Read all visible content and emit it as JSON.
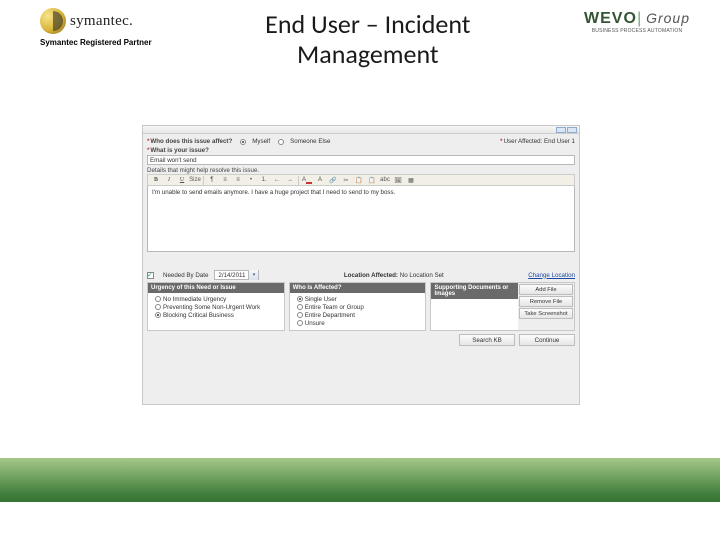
{
  "header": {
    "left_brand": "symantec.",
    "left_sub": "Symantec Registered Partner",
    "title_line1": "End User – Incident",
    "title_line2": "Management",
    "right_brand": "WEVO",
    "right_brand_suffix": "Group",
    "right_sub": "BUSINESS PROCESS AUTOMATION"
  },
  "form": {
    "q_affects": "Who does this issue affect?",
    "opt_myself": "Myself",
    "opt_someone": "Someone Else",
    "user_affected_label": "User Affected:",
    "user_affected_value": "End User 1",
    "q_issue": "What is your issue?",
    "issue_value": "Email won't send",
    "details_label": "Details that might help resolve this issue.",
    "details_body": "I'm unable to send emails anymore. I have a huge project that I need to send to my boss.",
    "needed_by_label": "Needed By Date",
    "needed_by_value": "2/14/2011",
    "loc_label": "Location Affected:",
    "loc_value": "No Location Set",
    "loc_link": "Change Location",
    "urgency": {
      "head": "Urgency of this Need or Issue",
      "opts": [
        "No Immediate Urgency",
        "Preventing Some Non-Urgent Work",
        "Blocking Critical Business"
      ],
      "selected": 2
    },
    "affected": {
      "head": "Who is Affected?",
      "opts": [
        "Single User",
        "Entire Team or Group",
        "Entire Department",
        "Unsure"
      ],
      "selected": 0
    },
    "supporting": {
      "head": "Supporting Documents or Images",
      "add": "Add File",
      "remove": "Remove File",
      "screenshot": "Take Screenshot"
    },
    "btn_search": "Search KB",
    "btn_continue": "Continue"
  },
  "toolbar_icons": [
    "B",
    "I",
    "U",
    "Size",
    "¶",
    "≡",
    "≡",
    "•",
    "1.",
    "←",
    "→",
    "A",
    "A",
    "🔗",
    "✂",
    "📋",
    "📋",
    "abc",
    "🖼",
    "▦"
  ]
}
